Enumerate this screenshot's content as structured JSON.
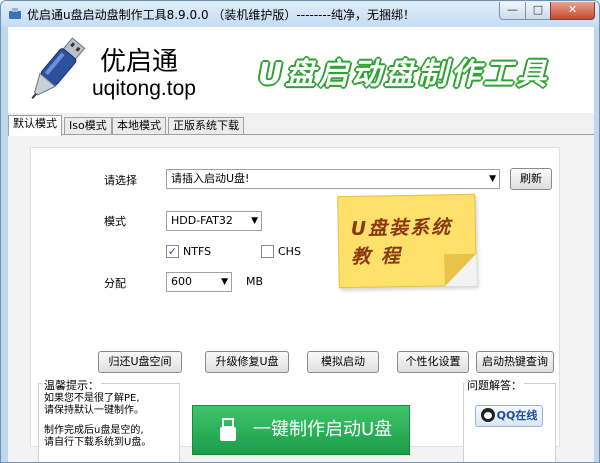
{
  "window": {
    "title": "优启通u盘启动盘制作工具8.9.0.0 （装机维护版）--------纯净，无捆绑！",
    "minimize": "—",
    "maximize": "□",
    "close": "✕"
  },
  "header": {
    "brand_name": "优启通",
    "brand_url": "uqitong.top",
    "slogan": "U盘启动盘制作工具"
  },
  "tabs": [
    {
      "label": "默认模式",
      "active": true
    },
    {
      "label": "Iso模式",
      "active": false
    },
    {
      "label": "本地模式",
      "active": false
    },
    {
      "label": "正版系统下载",
      "active": false
    }
  ],
  "form": {
    "select_label": "请选择",
    "device_value": "请插入启动U盘!",
    "refresh_label": "刷新",
    "mode_label": "模式",
    "mode_value": "HDD-FAT32",
    "ntfs_label": "NTFS",
    "ntfs_checked": "✓",
    "chs_label": "CHS",
    "alloc_label": "分配",
    "alloc_value": "600",
    "alloc_unit": "MB"
  },
  "promo": {
    "line1": "U盘装系统",
    "line2": "教 程"
  },
  "actions": [
    {
      "label": "归还U盘空间"
    },
    {
      "label": "升级修复U盘"
    },
    {
      "label": "模拟启动"
    },
    {
      "label": "个性化设置"
    },
    {
      "label": "启动热键查询"
    }
  ],
  "tips": {
    "title": "温馨提示：",
    "line1": "如果您不是很了解PE,",
    "line2": "请保持默认一键制作。",
    "line3": "制作完成后u盘是空的,",
    "line4": "请自行下载系统到U盘。"
  },
  "main_button": "一键制作启动U盘",
  "help": {
    "title": "问题解答：",
    "qq_label": "QQ在线"
  },
  "colors": {
    "accent_green": "#2ea233",
    "button_green": "#1c9d4a",
    "sticky_yellow": "#ffe06a"
  }
}
